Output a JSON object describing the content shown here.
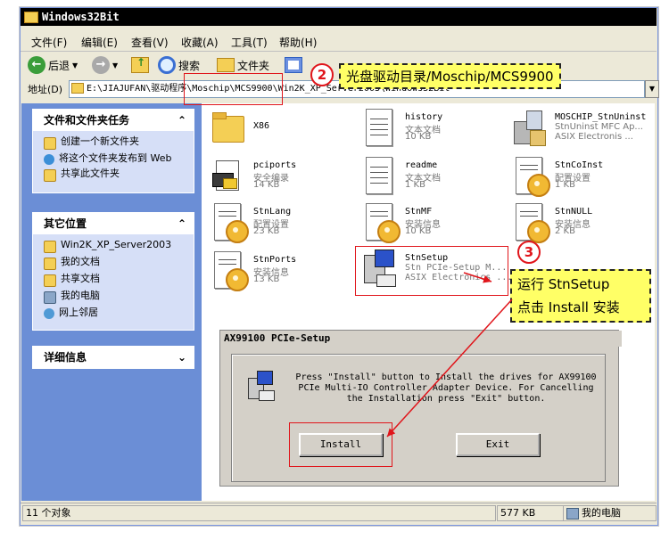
{
  "window": {
    "title": "Windows32Bit"
  },
  "menu": [
    "文件(F)",
    "编辑(E)",
    "查看(V)",
    "收藏(A)",
    "工具(T)",
    "帮助(H)"
  ],
  "toolbar": {
    "back": "后退",
    "search": "搜索",
    "folders": "文件夹"
  },
  "address": {
    "label": "地址(D)",
    "value": "E:\\JIAJUFAN\\驱动程序\\Moschip\\MCS9900\\Win2K_XP_Server2003\\Windows32Bit"
  },
  "tasks": {
    "title": "文件和文件夹任务",
    "items": [
      "创建一个新文件夹",
      "将这个文件夹发布到 Web",
      "共享此文件夹"
    ]
  },
  "places": {
    "title": "其它位置",
    "items": [
      "Win2K_XP_Server2003",
      "我的文档",
      "共享文档",
      "我的电脑",
      "网上邻居"
    ]
  },
  "details": {
    "title": "详细信息"
  },
  "files": [
    {
      "name": "X86",
      "type": "",
      "size": ""
    },
    {
      "name": "history",
      "type": "文本文档",
      "size": "10 KB"
    },
    {
      "name": "MOSCHIP_StnUninst",
      "type": "StnUninst MFC Ap...",
      "size": "ASIX Electronis ..."
    },
    {
      "name": "pciports",
      "type": "安全编录",
      "size": "14 KB"
    },
    {
      "name": "readme",
      "type": "文本文档",
      "size": "1 KB"
    },
    {
      "name": "StnCoInst",
      "type": "配置设置",
      "size": "1 KB"
    },
    {
      "name": "StnLang",
      "type": "配置设置",
      "size": "23 KB"
    },
    {
      "name": "StnMF",
      "type": "安装信息",
      "size": "10 KB"
    },
    {
      "name": "StnNULL",
      "type": "安装信息",
      "size": "2 KB"
    },
    {
      "name": "StnPorts",
      "type": "安装信息",
      "size": "13 KB"
    },
    {
      "name": "StnSetup",
      "type": "Stn PCIe-Setup M...",
      "size": "ASIX Electronics ..."
    }
  ],
  "status": {
    "count": "11 个对象",
    "size": "577 KB",
    "location": "我的电脑"
  },
  "dialog": {
    "title": "AX99100 PCIe-Setup",
    "message": "Press \"Install\" button to Install the drives for AX99100 PCIe Multi-IO Controller Adapter Device. For Cancelling the Installation press \"Exit\" button.",
    "install": "Install",
    "exit": "Exit"
  },
  "annotations": {
    "step2_num": "2",
    "step2_text": "光盘驱动目录/Moschip/MCS9900",
    "step3_num": "3",
    "step3_line1": "运行 StnSetup",
    "step3_line2": "点击 Install 安装"
  }
}
